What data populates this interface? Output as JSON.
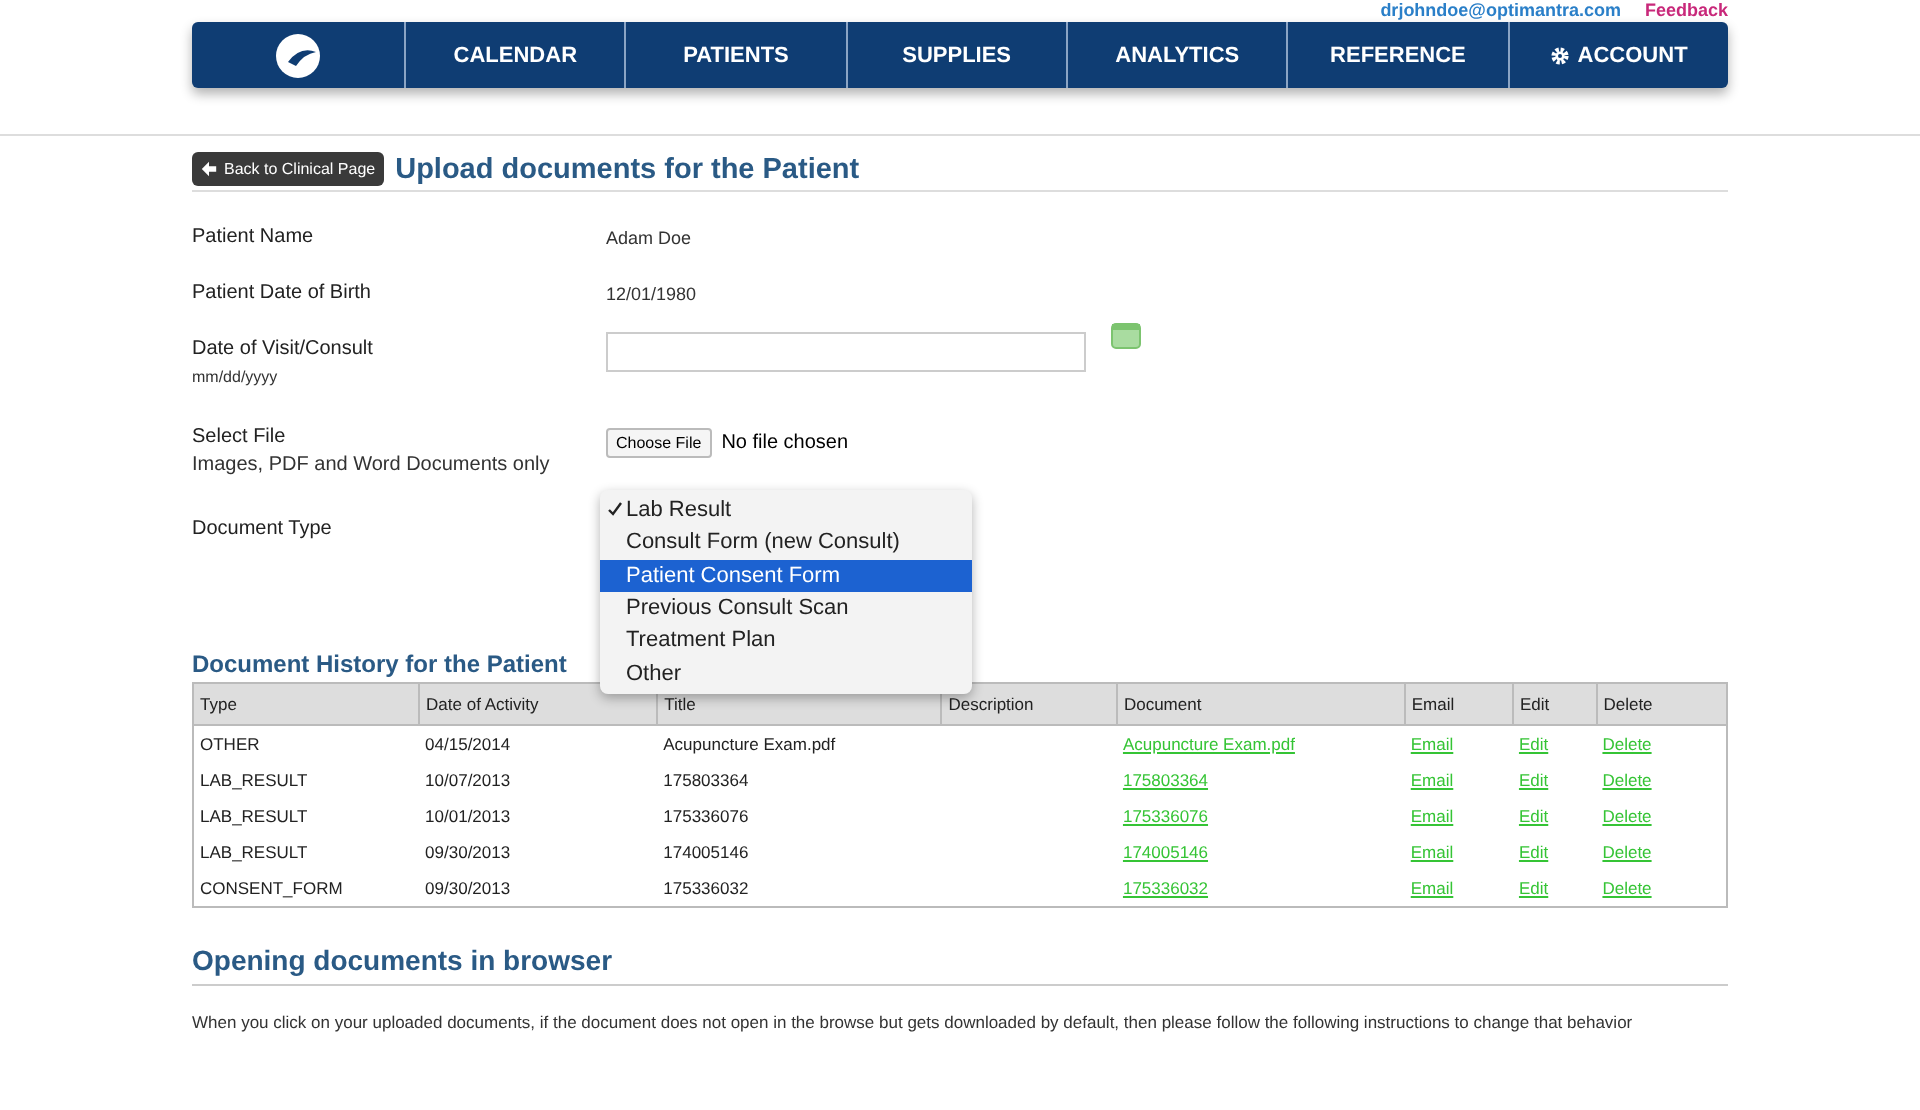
{
  "top_links": {
    "email": "drjohndoe@optimantra.com",
    "feedback": "Feedback"
  },
  "nav": [
    {
      "label": "CALENDAR",
      "kind": "plain"
    },
    {
      "label": "PATIENTS",
      "kind": "plain"
    },
    {
      "label": "SUPPLIES",
      "kind": "plain"
    },
    {
      "label": "ANALYTICS",
      "kind": "plain"
    },
    {
      "label": "REFERENCE",
      "kind": "plain"
    },
    {
      "label": "ACCOUNT",
      "kind": "settings"
    }
  ],
  "back_button": "Back to Clinical Page",
  "page_title": "Upload documents for the Patient",
  "form": [
    {
      "kind": "text",
      "label": "Patient Name",
      "value": "Adam Doe"
    },
    {
      "kind": "text",
      "label": "Patient Date of Birth",
      "value": "12/01/1980"
    },
    {
      "kind": "date",
      "label": "Date of Visit/Consult",
      "hint": "mm/dd/yyyy"
    },
    {
      "kind": "file",
      "label": "Select File",
      "hint": "Images, PDF and Word Documents only",
      "button": "Choose File",
      "status": "No file chosen"
    },
    {
      "kind": "select",
      "label": "Document Type"
    }
  ],
  "document_type_menu": [
    {
      "label": "Lab Result",
      "checked": true,
      "highlighted": false
    },
    {
      "label": "Consult Form (new Consult)",
      "checked": false,
      "highlighted": false
    },
    {
      "label": "Patient Consent Form",
      "checked": false,
      "highlighted": true
    },
    {
      "label": "Previous Consult Scan",
      "checked": false,
      "highlighted": false
    },
    {
      "label": "Treatment Plan",
      "checked": false,
      "highlighted": false
    },
    {
      "label": "Other",
      "checked": false,
      "highlighted": false
    }
  ],
  "history_title": "Document History for the Patient",
  "table": {
    "columns": [
      "Type",
      "Date of Activity",
      "Title",
      "Description",
      "Document",
      "Email",
      "Edit",
      "Delete"
    ],
    "rows": [
      [
        "OTHER",
        "04/15/2014",
        "Acupuncture Exam.pdf",
        "",
        "Acupuncture Exam.pdf",
        "Email",
        "Edit",
        "Delete"
      ],
      [
        "LAB_RESULT",
        "10/07/2013",
        "175803364",
        "",
        "175803364",
        "Email",
        "Edit",
        "Delete"
      ],
      [
        "LAB_RESULT",
        "10/01/2013",
        "175336076",
        "",
        "175336076",
        "Email",
        "Edit",
        "Delete"
      ],
      [
        "LAB_RESULT",
        "09/30/2013",
        "174005146",
        "",
        "174005146",
        "Email",
        "Edit",
        "Delete"
      ],
      [
        "CONSENT_FORM",
        "09/30/2013",
        "175336032",
        "",
        "175336032",
        "Email",
        "Edit",
        "Delete"
      ]
    ]
  },
  "browser_section": {
    "title": "Opening documents in browser",
    "text": "When you click on your uploaded documents, if the document does not open in the browse but gets downloaded by default, then please follow the following instructions to change that behavior"
  }
}
